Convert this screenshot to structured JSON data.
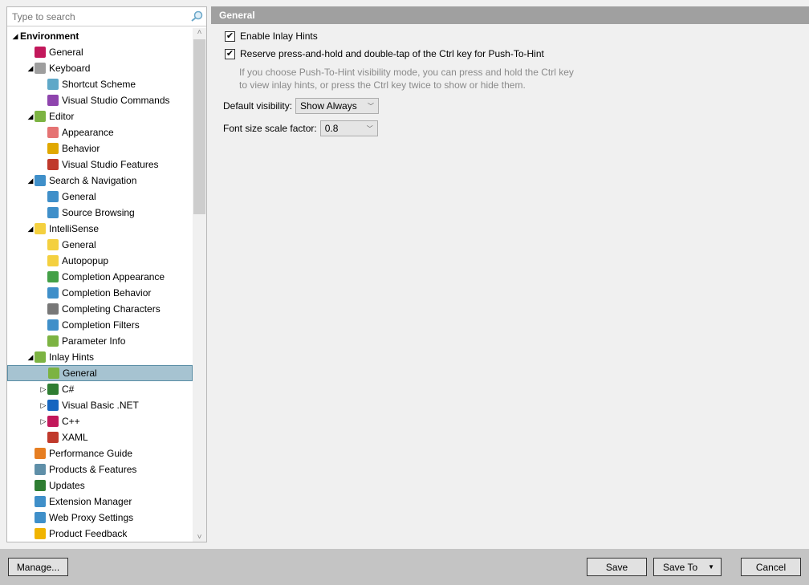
{
  "search": {
    "placeholder": "Type to search"
  },
  "tree": [
    {
      "label": "Environment",
      "level": 0,
      "expanded": true,
      "bold": true
    },
    {
      "label": "General",
      "level": 1,
      "icon": "resharper-icon",
      "color": "#c2185b"
    },
    {
      "label": "Keyboard",
      "level": 1,
      "expanded": true,
      "icon": "keyboard-icon",
      "color": "#9e9e9e"
    },
    {
      "label": "Shortcut Scheme",
      "level": 2,
      "icon": "wrench-icon",
      "color": "#5fa8c8"
    },
    {
      "label": "Visual Studio Commands",
      "level": 2,
      "icon": "visual-studio-icon",
      "color": "#8e44ad"
    },
    {
      "label": "Editor",
      "level": 1,
      "expanded": true,
      "icon": "pencil-icon",
      "color": "#7cb342"
    },
    {
      "label": "Appearance",
      "level": 2,
      "icon": "palette-icon",
      "color": "#e57373"
    },
    {
      "label": "Behavior",
      "level": 2,
      "icon": "gear-icon",
      "color": "#e0a800"
    },
    {
      "label": "Visual Studio Features",
      "level": 2,
      "icon": "features-icon",
      "color": "#c0392b"
    },
    {
      "label": "Search & Navigation",
      "level": 1,
      "expanded": true,
      "icon": "magnifier-icon",
      "color": "#3f8fc9"
    },
    {
      "label": "General",
      "level": 2,
      "icon": "magnifier-icon",
      "color": "#3f8fc9"
    },
    {
      "label": "Source Browsing",
      "level": 2,
      "icon": "globe-icon",
      "color": "#3f8fc9"
    },
    {
      "label": "IntelliSense",
      "level": 1,
      "expanded": true,
      "icon": "lightbulb-icon",
      "color": "#f4d03f"
    },
    {
      "label": "General",
      "level": 2,
      "icon": "lightbulb-icon",
      "color": "#f4d03f"
    },
    {
      "label": "Autopopup",
      "level": 2,
      "icon": "autopopup-icon",
      "color": "#f4d03f"
    },
    {
      "label": "Completion Appearance",
      "level": 2,
      "icon": "completion-appearance-icon",
      "color": "#43a047"
    },
    {
      "label": "Completion Behavior",
      "level": 2,
      "icon": "completion-behavior-icon",
      "color": "#3f8fc9"
    },
    {
      "label": "Completing Characters",
      "level": 2,
      "icon": "characters-icon",
      "color": "#777777"
    },
    {
      "label": "Completion Filters",
      "level": 2,
      "icon": "filter-icon",
      "color": "#3f8fc9"
    },
    {
      "label": "Parameter Info",
      "level": 2,
      "icon": "parameter-info-icon",
      "color": "#7cb342"
    },
    {
      "label": "Inlay Hints",
      "level": 1,
      "expanded": true,
      "icon": "inlay-hints-icon",
      "color": "#7cb342"
    },
    {
      "label": "General",
      "level": 2,
      "icon": "inlay-hints-icon",
      "color": "#7cb342",
      "selected": true
    },
    {
      "label": "C#",
      "level": 2,
      "collapsed": true,
      "icon": "csharp-icon",
      "color": "#2e7d32"
    },
    {
      "label": "Visual Basic .NET",
      "level": 2,
      "collapsed": true,
      "icon": "vb-icon",
      "color": "#1565c0"
    },
    {
      "label": "C++",
      "level": 2,
      "collapsed": true,
      "icon": "cpp-icon",
      "color": "#c2185b"
    },
    {
      "label": "XAML",
      "level": 2,
      "icon": "xaml-icon",
      "color": "#c0392b"
    },
    {
      "label": "Performance Guide",
      "level": 1,
      "icon": "performance-icon",
      "color": "#e67e22"
    },
    {
      "label": "Products & Features",
      "level": 1,
      "icon": "products-icon",
      "color": "#5f8fa8"
    },
    {
      "label": "Updates",
      "level": 1,
      "icon": "updates-icon",
      "color": "#2e7d32"
    },
    {
      "label": "Extension Manager",
      "level": 1,
      "icon": "extension-icon",
      "color": "#3f8fc9"
    },
    {
      "label": "Web Proxy Settings",
      "level": 1,
      "icon": "proxy-icon",
      "color": "#3f8fc9"
    },
    {
      "label": "Product Feedback",
      "level": 1,
      "icon": "envelope-icon",
      "color": "#f0b400"
    }
  ],
  "panel": {
    "title": "General",
    "enable_hints": {
      "label": "Enable Inlay Hints",
      "checked": true
    },
    "reserve_ctrl": {
      "label": "Reserve press-and-hold and double-tap of the Ctrl key for Push-To-Hint",
      "checked": true
    },
    "hint_line1": "If you choose Push-To-Hint visibility mode, you can press and hold the Ctrl key",
    "hint_line2": "to view inlay hints, or press the Ctrl key twice to show or hide them.",
    "visibility_label": "Default visibility:",
    "visibility_value": "Show Always",
    "scale_label": "Font size scale factor:",
    "scale_value": "0.8"
  },
  "buttons": {
    "manage": "Manage...",
    "save": "Save",
    "save_to": "Save To",
    "cancel": "Cancel"
  }
}
